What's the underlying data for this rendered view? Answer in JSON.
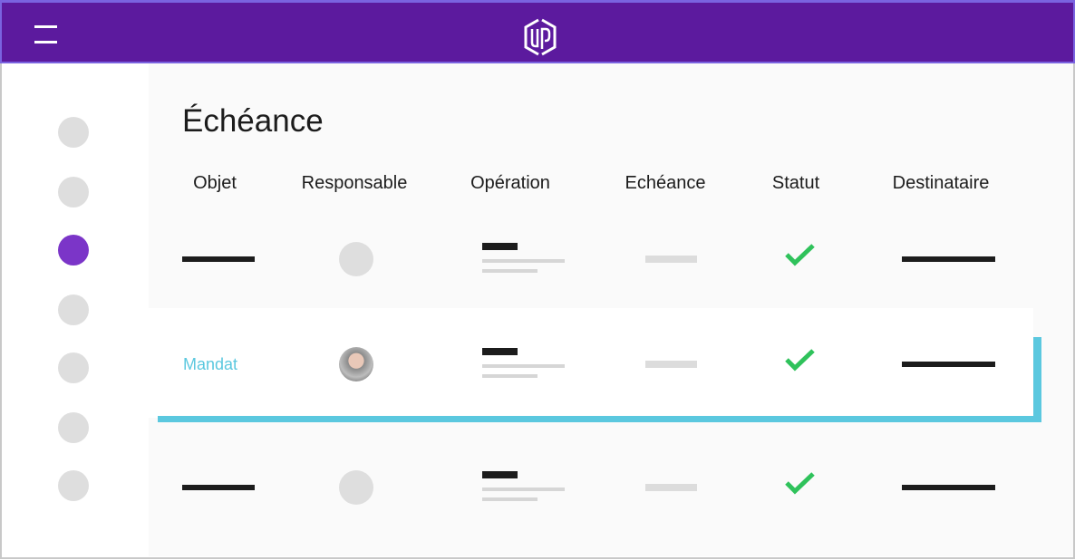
{
  "header": {
    "menu_icon": "hamburger-icon",
    "logo_icon": "up-hexagon-logo",
    "brand_color": "#5c1a9e"
  },
  "sidebar": {
    "items": [
      {
        "active": false
      },
      {
        "active": false
      },
      {
        "active": true
      },
      {
        "active": false
      },
      {
        "active": false
      },
      {
        "active": false
      },
      {
        "active": false
      }
    ],
    "active_color": "#7b35c8"
  },
  "main": {
    "title": "Échéance",
    "columns": [
      "Objet",
      "Responsable",
      "Opération",
      "Echéance",
      "Statut",
      "Destinataire"
    ],
    "rows": [
      {
        "objet": null,
        "responsable": "placeholder",
        "statut": "check-icon"
      },
      {
        "objet": "Mandat",
        "responsable": "avatar-photo",
        "statut": "check-icon",
        "highlighted": true
      },
      {
        "objet": null,
        "responsable": "placeholder",
        "statut": "check-icon"
      }
    ],
    "highlight_color": "#5bc8df"
  }
}
